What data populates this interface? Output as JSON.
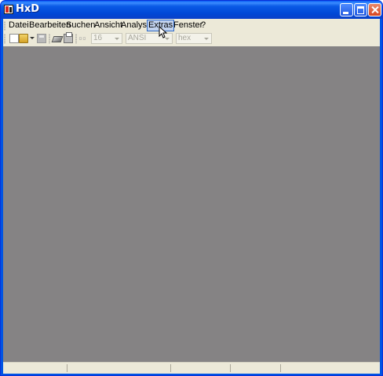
{
  "window": {
    "title": "HxD",
    "buttons": [
      "minimize",
      "maximize",
      "close"
    ]
  },
  "menu": {
    "items": [
      {
        "label": "Datei"
      },
      {
        "label": "Bearbeiten"
      },
      {
        "label": "Suchen"
      },
      {
        "label": "Ansicht"
      },
      {
        "label": "Analyse"
      },
      {
        "label": "Extras",
        "hovered": true
      },
      {
        "label": "Fenster"
      },
      {
        "label": "?"
      }
    ]
  },
  "toolbar": {
    "icons": [
      "new-file-icon",
      "open-folder-icon",
      "save-icon",
      "erase-icon",
      "print-icon",
      "bytes-per-row-icon"
    ],
    "bytes_per_row": "16",
    "charset": "ANSI",
    "offset_base": "hex",
    "enabled": false
  },
  "statusbar": {
    "panels": [
      "",
      "",
      "",
      "",
      ""
    ]
  },
  "colors": {
    "titlebar": "#0054e3",
    "workspace": "#858384",
    "face": "#ece9d8",
    "menu_hover": "#c1d2ee"
  }
}
